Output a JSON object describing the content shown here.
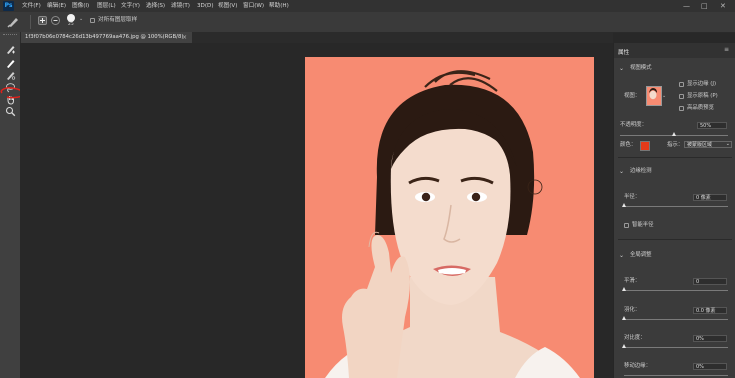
{
  "app": {
    "logo": "Ps"
  },
  "menu": [
    "文件(F)",
    "编辑(E)",
    "图像(I)",
    "图层(L)",
    "文字(Y)",
    "选择(S)",
    "滤镜(T)",
    "3D(D)",
    "视图(V)",
    "窗口(W)",
    "帮助(H)"
  ],
  "window_controls": {
    "minimize": "—",
    "maximize": "□",
    "close": "✕"
  },
  "options_bar": {
    "brush_size": "25",
    "sample_all_layers": "对所有图层取样"
  },
  "document": {
    "tab_title": "1f3f07b06e0784c26d13b497769aa476.jpg @ 100%(RGB/8)",
    "tab_close": "×",
    "background_color": "#f78b72"
  },
  "tools": [
    "brush-add-icon",
    "refine-edge-brush-icon",
    "brush-icon",
    "lasso-icon",
    "hand-icon",
    "zoom-icon"
  ],
  "annotation": {
    "color": "#e0201a"
  },
  "properties": {
    "tab": "属性",
    "view_mode_title": "视图模式",
    "view_label": "视图：",
    "show_edge": "显示边缘 (J)",
    "show_original": "显示原稿 (P)",
    "high_quality_preview": "高品质预览",
    "opacity_label": "不透明度：",
    "opacity_value": "50%",
    "opacity_level": 0.5,
    "color_label": "颜色：",
    "color_value": "#e53b1a",
    "indicates_label": "指示：",
    "indicates_value": "被蒙版区域",
    "edge_detection_title": "边缘检测",
    "radius_label": "半径：",
    "radius_value": "0 像素",
    "smart_radius": "智能半径",
    "global_refine_title": "全局调整",
    "smooth_label": "平滑：",
    "smooth_value": "0",
    "feather_label": "羽化：",
    "feather_value": "0.0 像素",
    "contrast_label": "对比度：",
    "contrast_value": "0%",
    "shift_edge_label": "移动边缘：",
    "shift_edge_value": "0%"
  }
}
